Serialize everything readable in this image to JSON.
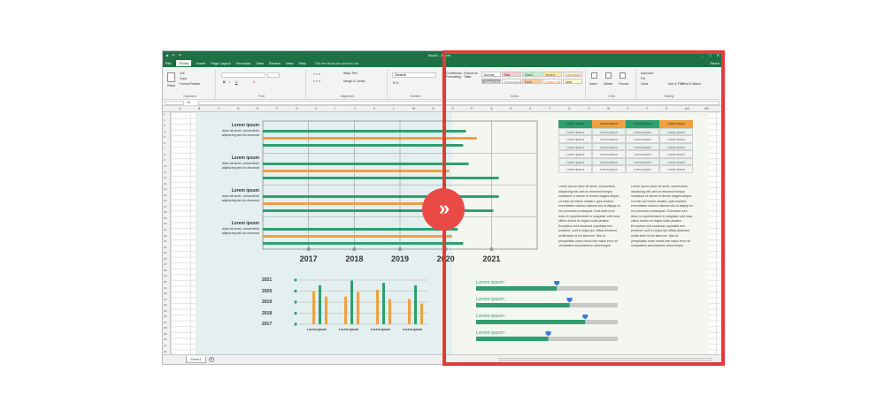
{
  "titlebar": {
    "title": "Book1 - Excel",
    "qat": [
      "save-icon",
      "undo-icon",
      "redo-icon"
    ]
  },
  "menu": {
    "tabs": [
      "File",
      "Home",
      "Insert",
      "Page Layout",
      "Formulas",
      "Data",
      "Review",
      "View",
      "Help"
    ],
    "active": "Home",
    "tell_me": "Tell me what you want to do",
    "share": "Share"
  },
  "ribbon": {
    "clipboard": {
      "paste": "Paste",
      "cut": "Cut",
      "copy": "Copy",
      "format_painter": "Format Painter",
      "label": "Clipboard"
    },
    "font": {
      "label": "Font",
      "bold": "B",
      "italic": "I",
      "underline": "U"
    },
    "alignment": {
      "wrap": "Wrap Text",
      "merge": "Merge & Center",
      "label": "Alignment"
    },
    "number": {
      "format": "General",
      "label": "Number"
    },
    "styles": {
      "conditional": "Conditional Formatting",
      "format_table": "Format as Table",
      "cells": [
        {
          "label": "Normal",
          "bg": "#ffffff",
          "color": "#333333"
        },
        {
          "label": "Bad",
          "bg": "#ffc7ce",
          "color": "#9c0006"
        },
        {
          "label": "Good",
          "bg": "#c6efce",
          "color": "#006100"
        },
        {
          "label": "Neutral",
          "bg": "#ffeb9c",
          "color": "#9c5700"
        },
        {
          "label": "Calculation",
          "bg": "#f2f2f2",
          "color": "#fa7d00"
        },
        {
          "label": "Check Cell",
          "bg": "#a5a5a5",
          "color": "#ffffff"
        },
        {
          "label": "Explanatory...",
          "bg": "#ffffff",
          "color": "#7f7f7f"
        },
        {
          "label": "Input",
          "bg": "#ffcc99",
          "color": "#3f3f76"
        },
        {
          "label": "Linked Cell",
          "bg": "#ffffff",
          "color": "#fa7d00"
        },
        {
          "label": "Note",
          "bg": "#ffffcc",
          "color": "#333333"
        }
      ],
      "label": "Styles"
    },
    "cells": {
      "insert": "Insert",
      "delete": "Delete",
      "format": "Format",
      "label": "Cells"
    },
    "editing": {
      "autosum": "AutoSum",
      "fill": "Fill",
      "clear": "Clear",
      "sort": "Sort & Filter",
      "find": "Find & Select",
      "label": "Editing"
    }
  },
  "columns": [
    "A",
    "B",
    "C",
    "D",
    "E",
    "F",
    "G",
    "H",
    "I",
    "J",
    "K",
    "L",
    "M",
    "N",
    "O",
    "P",
    "Q",
    "R",
    "S",
    "T",
    "U",
    "V",
    "W",
    "X",
    "Y",
    "Z",
    "AA",
    "AB"
  ],
  "rows": [
    "1",
    "2",
    "3",
    "4",
    "5",
    "6",
    "7",
    "8",
    "9",
    "10",
    "11",
    "12",
    "13",
    "14",
    "15",
    "16",
    "17",
    "18",
    "19",
    "20",
    "21",
    "22",
    "23",
    "24",
    "25",
    "26",
    "27",
    "28",
    "29",
    "30",
    "31",
    "32",
    "33",
    "34",
    "35",
    "36",
    "37",
    "38",
    "39",
    "40",
    "41",
    "42"
  ],
  "chart1": {
    "labels": [
      {
        "title": "Lorem ipsum",
        "body": "dolor sit amet, consectetur adipiscing sed do eiusmod"
      },
      {
        "title": "Lorem ipsum",
        "body": "dolor sit amet, consectetur adipiscing sed do eiusmod"
      },
      {
        "title": "Lorem ipsum",
        "body": "dolor sit amet, consectetur adipiscing sed do eiusmod"
      },
      {
        "title": "Lorem ipsum",
        "body": "dolor sit amet, consectetur adipiscing sed do eiusmod"
      }
    ],
    "years": [
      "2017",
      "2018",
      "2019",
      "2020",
      "2021"
    ]
  },
  "chart2": {
    "years": [
      "2021",
      "2020",
      "2019",
      "2018",
      "2017"
    ],
    "captions": [
      "Lorem ipsum",
      "Lorem ipsum",
      "Lorem ipsum",
      "Lorem ipsum"
    ]
  },
  "table": {
    "headers": [
      "Lorem ipsum",
      "Lorem ipsum",
      "Lorem ipsum",
      "Lorem ipsum"
    ],
    "header_colors": [
      "#2e9e6e",
      "#f0a040",
      "#2e9e6e",
      "#f0a040"
    ],
    "rows": [
      [
        "Lorem ipsum",
        "Lorem ipsum",
        "Lorem ipsum",
        "Lorem ipsum"
      ],
      [
        "Lorem ipsum",
        "Lorem ipsum",
        "Lorem ipsum",
        "Lorem ipsum"
      ],
      [
        "Lorem ipsum",
        "Lorem ipsum",
        "Lorem ipsum",
        "Lorem ipsum"
      ],
      [
        "Lorem ipsum",
        "Lorem ipsum",
        "Lorem ipsum",
        "Lorem ipsum"
      ],
      [
        "Lorem ipsum",
        "Lorem ipsum",
        "Lorem ipsum",
        "Lorem ipsum"
      ],
      [
        "Lorem ipsum",
        "Lorem ipsum",
        "Lorem ipsum",
        "Lorem ipsum"
      ]
    ]
  },
  "paragraph": "Lorem ipsum dolor sit amet, consectetur adipiscing elit, sed do eiusmod tempor incididunt ut labore et dolore magna aliqua. Ut enim ad minim veniam, quis nostrud exercitation ullamco laboris nisi ut aliquip ex ea commodo consequat. Duis aute irure dolor in reprehenderit in voluptate velit esse cillum dolore eu fugiat nulla pariatur. Excepteur sint occaecat cupidatat non proident, sunt in culpa qui officia deserunt mollit anim id est laborum. Sed ut perspiciatis unde omnis iste natus error sit voluptatem accusantium doloremque laudantium, totam rem aperiam, eaque ipsa quae ab illo inventore veritatis et quasi architecto beatae vitae dicta sunt explicabo. Nemo enim ipsam voluptatem quia voluptas sit aspernatur aut odit aut fugit, sed quia consequuntur magni dolores eos qui ratione voluptatem sequi nesciunt facilisis.",
  "progress": {
    "label": "Lorem ipsum",
    "levels": [
      0.57,
      0.66,
      0.77,
      0.51
    ]
  },
  "sheet_tab": "Sheet1",
  "add_sheet": "+",
  "colors": {
    "green": "#2e9e6e",
    "orange": "#f0a040",
    "excel_green": "#1e7145",
    "highlight": "#e03c3c"
  },
  "center_button": "»"
}
